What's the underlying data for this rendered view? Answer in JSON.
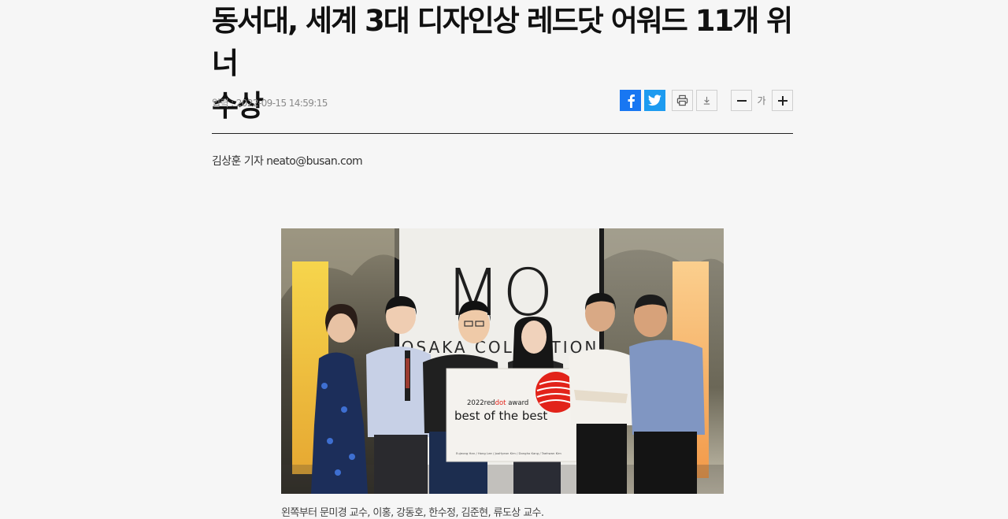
{
  "article": {
    "headline_line1": "동서대, 세계 3대 디자인상 레드닷 어워드 11개 위너",
    "headline_line2": "수상",
    "published": "입력 : 2022-09-15 14:59:15",
    "byline": "김상훈 기자 neato@busan.com",
    "photo": {
      "sign_text": "MO",
      "banner_text": "OSAKA COLLECTION",
      "award_year": "2022",
      "award_red": "red",
      "award_dot": "dot",
      "award_word": "award",
      "award_title": "best of the best",
      "award_names": "Eujeong Han  /  Hong Lee  /  JooHyeon Kim  /  Dongho Kang  /  Taehwan Kim"
    },
    "caption": "왼쪽부터 문미경 교수, 이홍, 강동호, 한수정, 김준현, 류도상 교수."
  },
  "toolbar": {
    "font_size_label": "가"
  },
  "icons": {
    "facebook": "facebook-icon",
    "twitter": "twitter-icon",
    "print": "print-icon",
    "download": "download-icon",
    "minus": "minus-icon",
    "plus": "plus-icon"
  },
  "colors": {
    "background": "#f6f6f6",
    "facebook": "#1877f2",
    "twitter": "#1d9bf0",
    "reddot": "#e2231a"
  }
}
